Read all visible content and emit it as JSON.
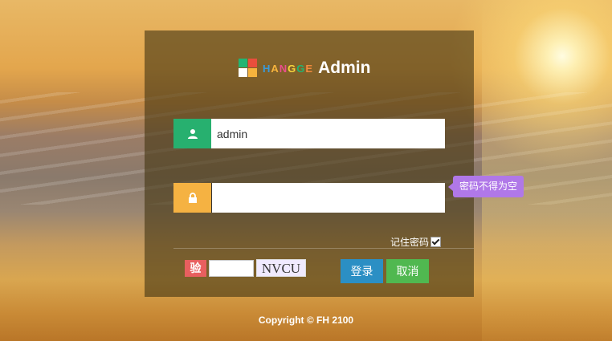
{
  "logo": {
    "brand_letters": [
      "H",
      "A",
      "N",
      "G",
      "G",
      "E"
    ],
    "title": "Admin"
  },
  "login": {
    "username_value": "admin",
    "password_value": "",
    "password_error_tooltip": "密码不得为空",
    "remember_label": "记住密码",
    "remember_checked": true,
    "verify_label": "验",
    "verify_value": "",
    "captcha_text": "NVCU",
    "login_button": "登录",
    "cancel_button": "取消"
  },
  "footer": {
    "copyright": "Copyright © FH 2100"
  },
  "colors": {
    "user_addon": "#27b06f",
    "pass_addon": "#f5b242",
    "tooltip": "#b078e8",
    "login_button": "#2b8fc4",
    "cancel_button": "#50b850",
    "verify_label": "#e85f5f"
  },
  "icons": {
    "user": "user-icon",
    "password": "lock-icon"
  }
}
